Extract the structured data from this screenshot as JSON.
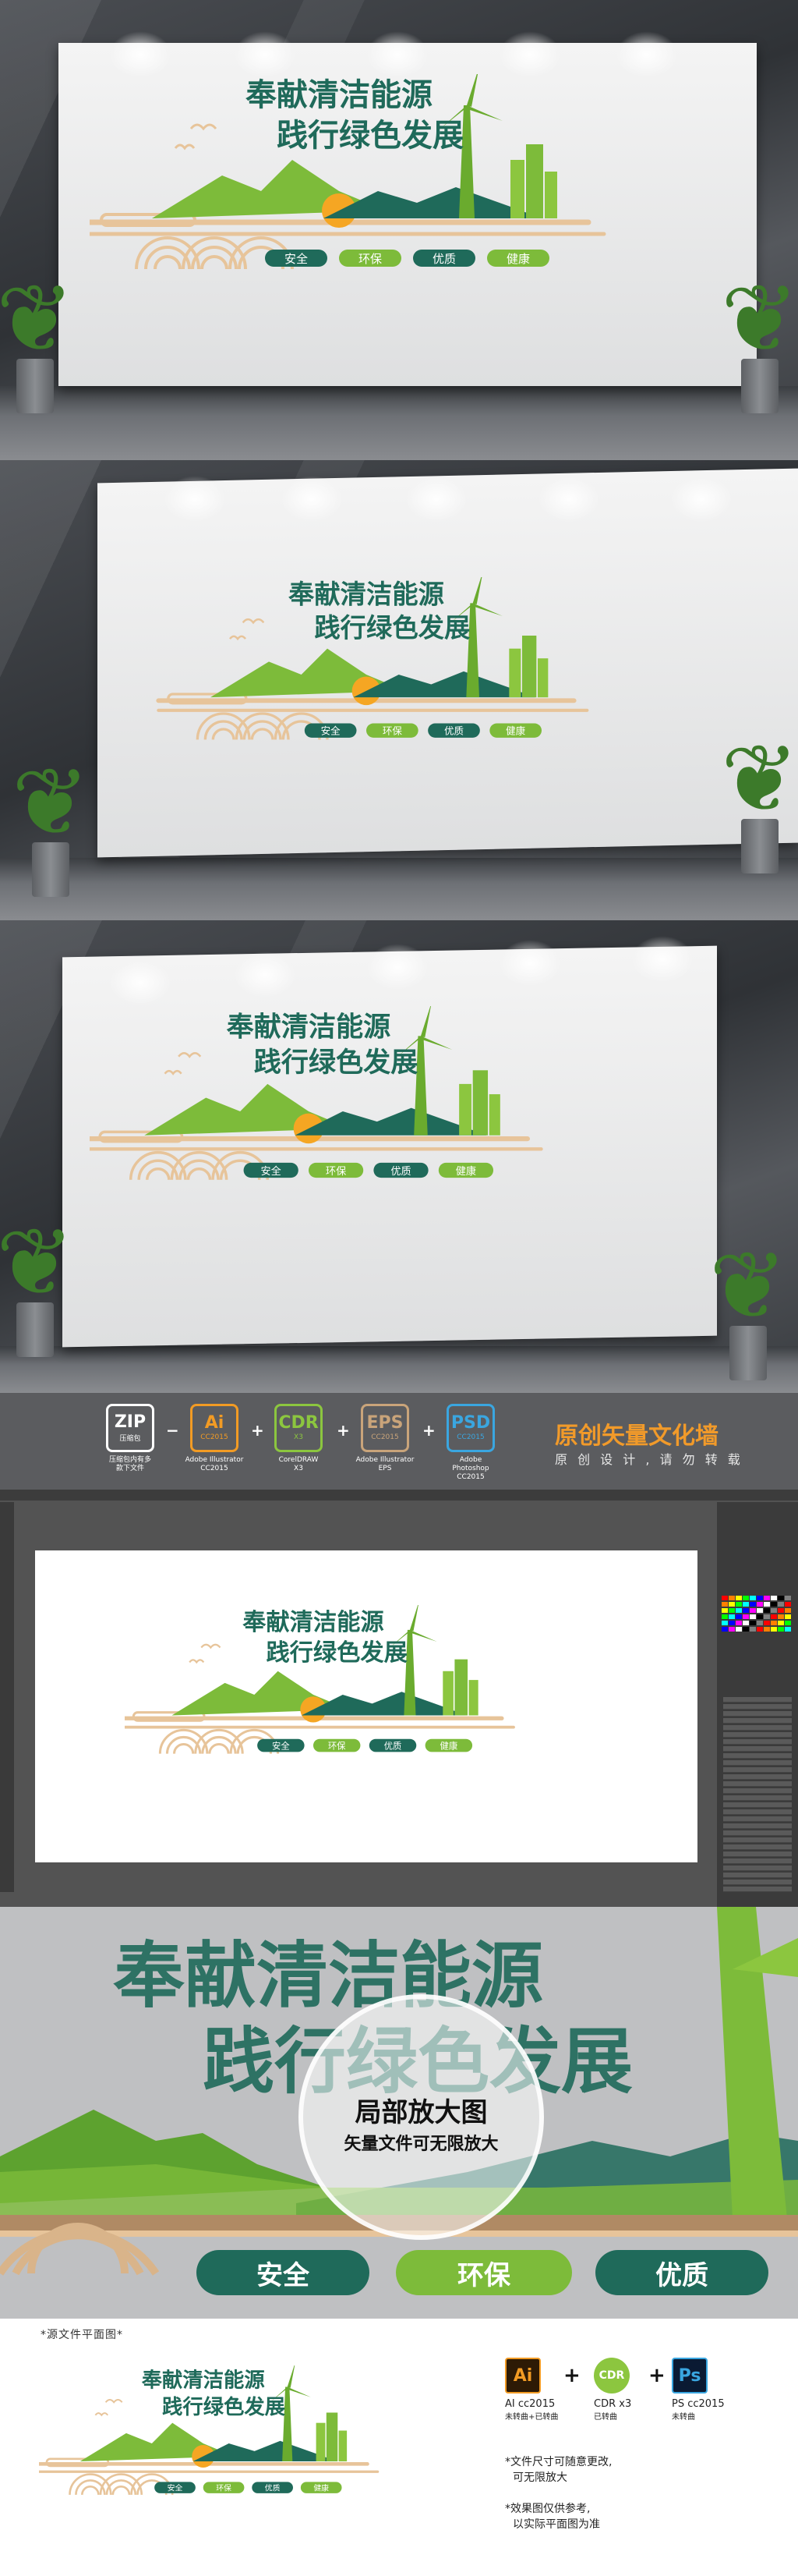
{
  "wall": {
    "title_line1": "奉献清洁能源",
    "title_line2": "践行绿色发展",
    "buttons": [
      "安全",
      "环保",
      "优质",
      "健康"
    ]
  },
  "formats": [
    {
      "name": "ZIP",
      "label": "压缩包",
      "caption": "压缩包内有多\n款下文件"
    },
    {
      "name": "Ai",
      "label": "CC2015",
      "caption": "Adobe Illustrator\nCC2015"
    },
    {
      "name": "CDR",
      "label": "X3 ",
      "caption": "CorelDRAW\nX3"
    },
    {
      "name": "EPS",
      "label": "CC2015",
      "caption": "Adobe Illustrator\nEPS"
    },
    {
      "name": "PSD",
      "label": "CC2015",
      "caption": "Adobe Photoshop\nCC2015"
    }
  ],
  "brand": {
    "title": "原创矢量文化墙",
    "subtitle": "原 创 设 计 , 请 勿 转 载"
  },
  "zoom": {
    "title": "局部放大图",
    "subtitle": "矢量文件可无限放大",
    "big_line1": "奉献清洁能源",
    "big_line2": "践行绿色发展",
    "buttons": [
      "安全",
      "环保",
      "优质"
    ]
  },
  "flat": {
    "label": "*源文件平面图*",
    "ai": {
      "icon": "Ai",
      "caption": "AI cc2015",
      "sub": "未转曲+已转曲"
    },
    "cdr": {
      "icon": "CDR",
      "caption": "CDR x3",
      "sub": "已转曲"
    },
    "ps": {
      "icon": "Ps",
      "caption": "PS cc2015",
      "sub": "未转曲"
    },
    "note1_line1": "*文件尺寸可随意更改,",
    "note1_line2": "可无限放大",
    "note2_line1": "*效果图仅供参考,",
    "note2_line2": "以实际平面图为准"
  },
  "colors": {
    "dark_green": "#1f6a5a",
    "light_green": "#7dbb3a",
    "tan": "#e7c49a",
    "sun": "#f5a623"
  }
}
